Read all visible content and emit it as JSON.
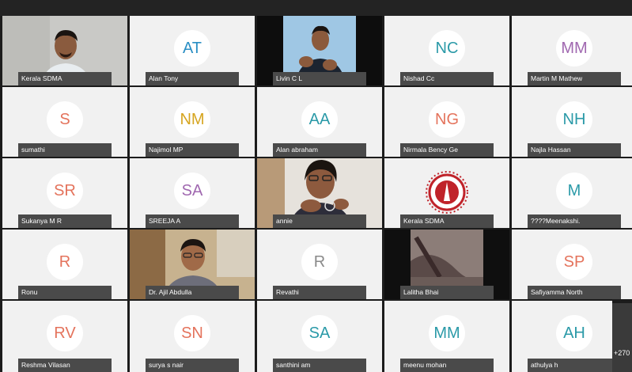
{
  "participants": [
    {
      "initials": "",
      "name": "Kerala SDMA",
      "video": "man-office"
    },
    {
      "initials": "AT",
      "name": "Alan Tony",
      "color": "#2b8fc4"
    },
    {
      "initials": "",
      "name": "Livin C L",
      "video": "sign-interpreter"
    },
    {
      "initials": "NC",
      "name": "Nishad Cc",
      "color": "#2b9aa8"
    },
    {
      "initials": "MM",
      "name": "Martin M Mathew",
      "color": "#a068b0"
    },
    {
      "initials": "S",
      "name": "sumathi",
      "color": "#e4735c"
    },
    {
      "initials": "NM",
      "name": "Najimol MP",
      "color": "#d6a520"
    },
    {
      "initials": "AA",
      "name": "Alan abraham",
      "color": "#2b9aa8"
    },
    {
      "initials": "NG",
      "name": "Nirmala Bency Ge",
      "color": "#e4735c"
    },
    {
      "initials": "NH",
      "name": "Najla Hassan",
      "color": "#2b9aa8"
    },
    {
      "initials": "SR",
      "name": "Sukanya M R",
      "color": "#e4735c"
    },
    {
      "initials": "SA",
      "name": "SREEJA A",
      "color": "#a068b0"
    },
    {
      "initials": "",
      "name": "annie",
      "video": "woman-speaking"
    },
    {
      "initials": "",
      "name": "Kerala SDMA",
      "video": "logo"
    },
    {
      "initials": "M",
      "name": "????Meenakshi.",
      "color": "#2b9aa8"
    },
    {
      "initials": "R",
      "name": "Ronu",
      "color": "#e4735c"
    },
    {
      "initials": "",
      "name": "Dr. Ajil Abdulla",
      "video": "man-room"
    },
    {
      "initials": "R",
      "name": "Revathi",
      "color": "#8a8a8a"
    },
    {
      "initials": "",
      "name": "Lalitha Bhai",
      "video": "blurred"
    },
    {
      "initials": "SP",
      "name": "Safiyamma North",
      "color": "#e4735c"
    },
    {
      "initials": "RV",
      "name": "Reshma Vilasan",
      "color": "#e4735c"
    },
    {
      "initials": "SN",
      "name": "surya s nair",
      "color": "#e4735c"
    },
    {
      "initials": "SA",
      "name": "santhini am",
      "color": "#2b9aa8"
    },
    {
      "initials": "MM",
      "name": "meenu mohan",
      "color": "#2b9aa8"
    },
    {
      "initials": "AH",
      "name": "athulya h",
      "color": "#2b9aa8"
    }
  ],
  "overflow": {
    "label": "+270"
  }
}
